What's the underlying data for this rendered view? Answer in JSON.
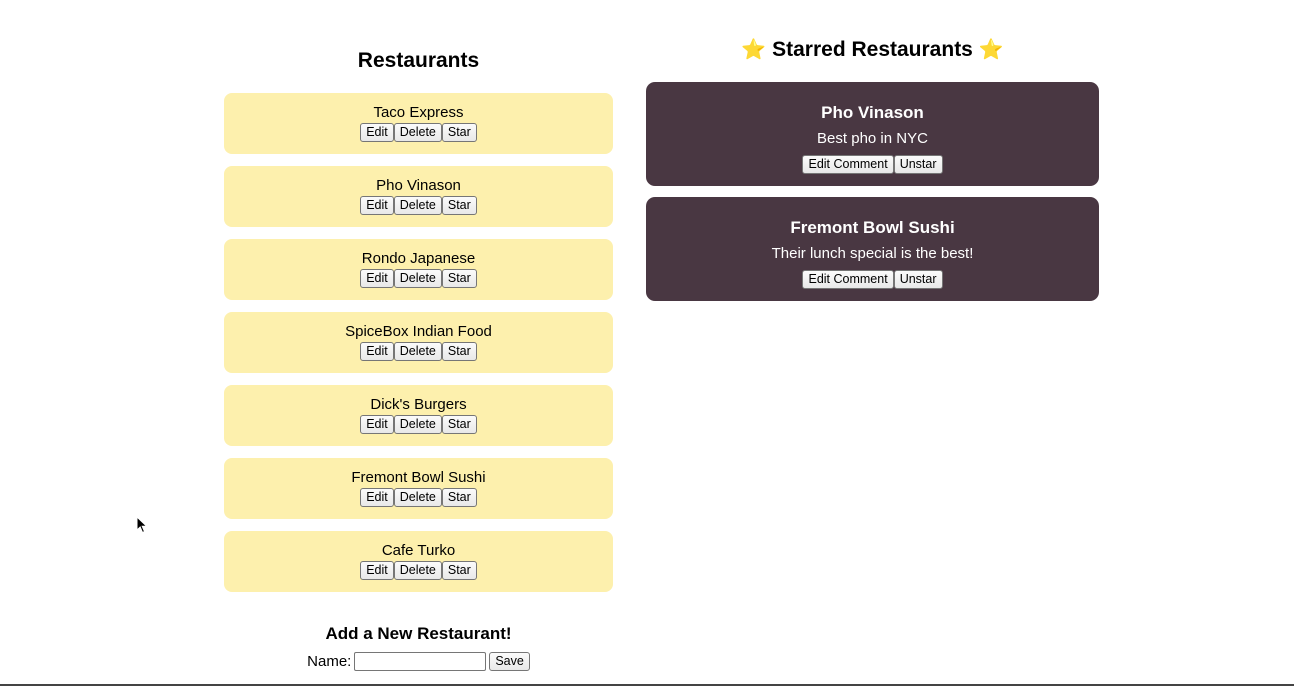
{
  "restaurants": {
    "title": "Restaurants",
    "items": [
      {
        "name": "Taco Express"
      },
      {
        "name": "Pho Vinason"
      },
      {
        "name": "Rondo Japanese"
      },
      {
        "name": "SpiceBox Indian Food"
      },
      {
        "name": "Dick's Burgers"
      },
      {
        "name": "Fremont Bowl Sushi"
      },
      {
        "name": "Cafe Turko"
      }
    ],
    "edit_label": "Edit",
    "delete_label": "Delete",
    "star_label": "Star"
  },
  "starred": {
    "title": "Starred Restaurants",
    "title_icon": "star-emoji",
    "items": [
      {
        "name": "Pho Vinason",
        "comment": "Best pho in NYC"
      },
      {
        "name": "Fremont Bowl Sushi",
        "comment": "Their lunch special is the best!"
      }
    ],
    "edit_comment_label": "Edit Comment",
    "unstar_label": "Unstar"
  },
  "add_form": {
    "title": "Add a New Restaurant!",
    "name_label": "Name:",
    "name_value": "",
    "save_label": "Save"
  },
  "colors": {
    "card_bg": "#fdf0ad",
    "starred_card_bg": "#493742",
    "star": "#f2b01e"
  }
}
